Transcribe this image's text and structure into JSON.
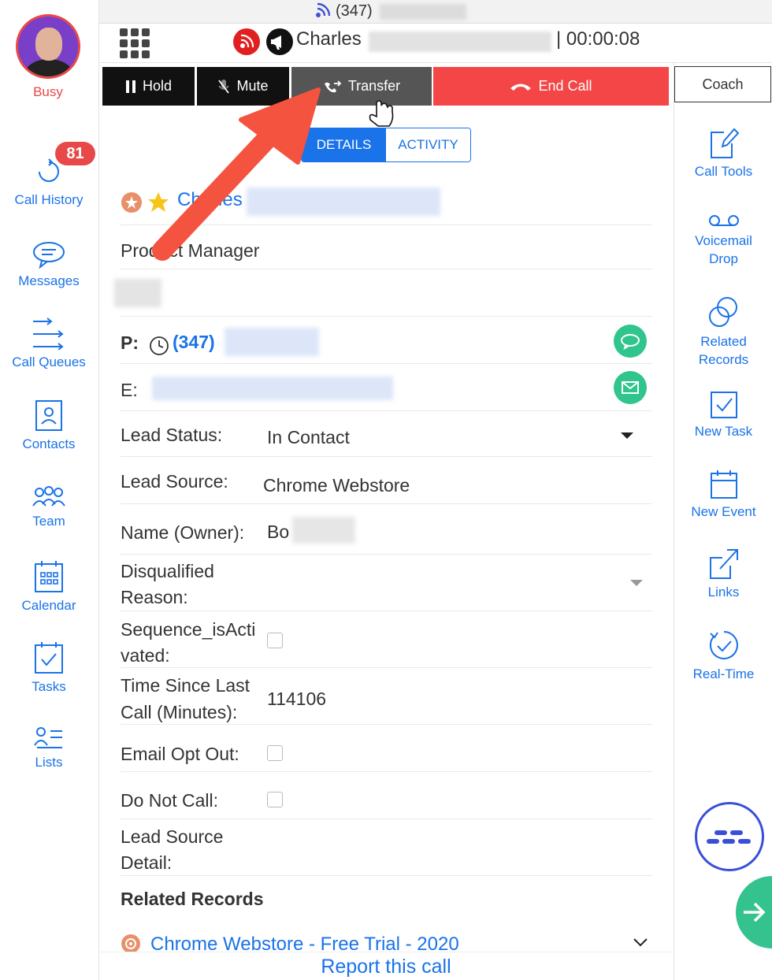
{
  "sidebar": {
    "status": "Busy",
    "call_history_badge": "81",
    "items": [
      {
        "label": "Call History"
      },
      {
        "label": "Messages"
      },
      {
        "label": "Call Queues"
      },
      {
        "label": "Contacts"
      },
      {
        "label": "Team"
      },
      {
        "label": "Calendar"
      },
      {
        "label": "Tasks"
      },
      {
        "label": "Lists"
      }
    ]
  },
  "header": {
    "caller_number_prefix": "(347)",
    "caller_name": "Charles",
    "timer": "| 00:00:08"
  },
  "controls": {
    "hold": "Hold",
    "mute": "Mute",
    "transfer": "Transfer",
    "end_call": "End Call",
    "coach": "Coach"
  },
  "tabs": {
    "details": "DETAILS",
    "activity": "ACTIVITY"
  },
  "contact": {
    "name_prefix": "Charles",
    "title": "Product Manager",
    "phone_label": "P:",
    "phone_prefix": "(347)",
    "email_label": "E:",
    "fields": [
      {
        "label": "Lead Status:",
        "value": "In Contact"
      },
      {
        "label": "Lead Source:",
        "value": "Chrome Webstore"
      },
      {
        "label": "Name (Owner):",
        "value": "Bo"
      },
      {
        "label_line1": "Disqualified",
        "label_line2": "Reason:"
      },
      {
        "label_line1": "Sequence_isActi",
        "label_line2": "vated:"
      },
      {
        "label_line1": "Time Since Last",
        "label_line2": "Call (Minutes):",
        "value": "114106"
      },
      {
        "label": "Email Opt Out:"
      },
      {
        "label": "Do Not Call:"
      },
      {
        "label_line1": "Lead Source",
        "label_line2": "Detail:"
      }
    ],
    "related_records_heading": "Related Records",
    "related_record_item": "Chrome Webstore - Free Trial - 2020"
  },
  "tools": [
    {
      "line1": "Call Tools"
    },
    {
      "line1": "Voicemail",
      "line2": "Drop"
    },
    {
      "line1": "Related",
      "line2": "Records"
    },
    {
      "line1": "New Task"
    },
    {
      "line1": "New Event"
    },
    {
      "line1": "Links"
    },
    {
      "line1": "Real-Time"
    }
  ],
  "footer": {
    "report": "Report this call"
  },
  "colors": {
    "accent": "#1a73e8",
    "end_call": "#f44646",
    "status_busy": "#e84848",
    "action_green": "#2fc58d",
    "arrow": "#f4533f"
  }
}
